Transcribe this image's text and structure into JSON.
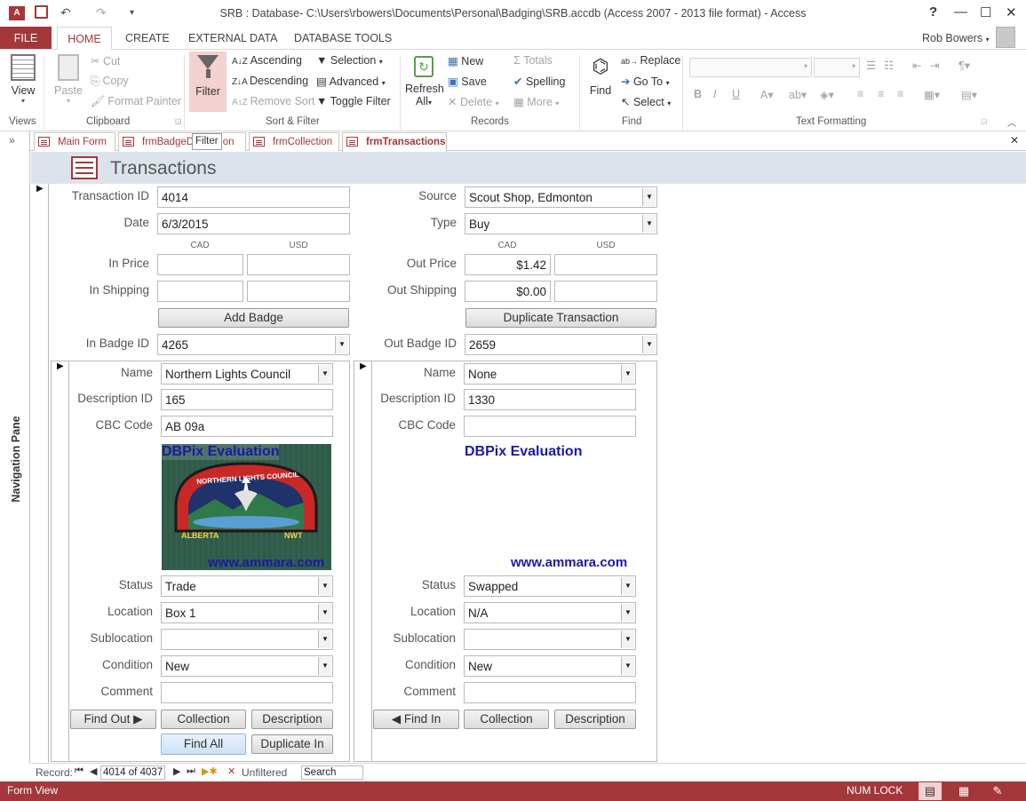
{
  "window": {
    "title": "SRB : Database- C:\\Users\\rbowers\\Documents\\Personal\\Badging\\SRB.accdb (Access 2007 - 2013 file format) - Access",
    "help": "?",
    "minimize": "—",
    "restore": "☐",
    "close": "✕"
  },
  "menu": {
    "file": "FILE",
    "tabs": [
      "HOME",
      "CREATE",
      "EXTERNAL DATA",
      "DATABASE TOOLS"
    ],
    "user": "Rob Bowers"
  },
  "ribbon": {
    "views": {
      "view": "View",
      "group": "Views"
    },
    "clipboard": {
      "paste": "Paste",
      "cut": "Cut",
      "copy": "Copy",
      "format_painter": "Format Painter",
      "group": "Clipboard"
    },
    "sort_filter": {
      "filter": "Filter",
      "ascending": "Ascending",
      "descending": "Descending",
      "remove_sort": "Remove Sort",
      "selection": "Selection",
      "advanced": "Advanced",
      "toggle_filter": "Toggle Filter",
      "group": "Sort & Filter"
    },
    "records": {
      "refresh": "Refresh",
      "refresh_all": "All",
      "new": "New",
      "save": "Save",
      "delete": "Delete",
      "totals": "Totals",
      "spelling": "Spelling",
      "more": "More",
      "group": "Records"
    },
    "find": {
      "find": "Find",
      "replace": "Replace",
      "goto": "Go To",
      "select": "Select",
      "group": "Find"
    },
    "text_formatting": {
      "group": "Text Formatting"
    }
  },
  "tooltip": "Filter",
  "doc_tabs": [
    "Main Form",
    "frmBadgeD",
    "ion",
    "frmCollection",
    "frmTransactions"
  ],
  "nav_pane": "Navigation Pane",
  "form": {
    "title": "Transactions",
    "transaction_id_label": "Transaction ID",
    "transaction_id": "4014",
    "date_label": "Date",
    "date": "6/3/2015",
    "source_label": "Source",
    "source": "Scout Shop, Edmonton",
    "type_label": "Type",
    "type": "Buy",
    "cad": "CAD",
    "usd": "USD",
    "in_price_label": "In Price",
    "in_shipping_label": "In Shipping",
    "out_price_label": "Out Price",
    "out_price_cad": "$1.42",
    "out_shipping_label": "Out Shipping",
    "out_shipping_cad": "$0.00",
    "add_badge": "Add Badge",
    "duplicate_transaction": "Duplicate Transaction",
    "in_badge_label": "In Badge ID",
    "in_badge": "4265",
    "out_badge_label": "Out Badge ID",
    "out_badge": "2659"
  },
  "left_sub": {
    "name_label": "Name",
    "name": "Northern Lights Council",
    "desc_label": "Description ID",
    "desc": "165",
    "cbc_label": "CBC Code",
    "cbc": "AB 09a",
    "watermark_top": "DBPix Evaluation",
    "watermark_bottom": "www.ammara.com",
    "patch_text_top": "NORTHERN LIGHTS COUNCIL",
    "patch_left": "ALBERTA",
    "patch_right": "NWT",
    "status_label": "Status",
    "status": "Trade",
    "location_label": "Location",
    "location": "Box 1",
    "subloc_label": "Sublocation",
    "subloc": "",
    "condition_label": "Condition",
    "condition": "New",
    "comment_label": "Comment",
    "find_out": "Find Out ▶",
    "collection": "Collection",
    "description": "Description",
    "find_all": "Find All",
    "duplicate_in": "Duplicate In"
  },
  "right_sub": {
    "name_label": "Name",
    "name": "None",
    "desc_label": "Description ID",
    "desc": "1330",
    "cbc_label": "CBC Code",
    "cbc": "",
    "watermark_top": "DBPix Evaluation",
    "watermark_bottom": "www.ammara.com",
    "status_label": "Status",
    "status": "Swapped",
    "location_label": "Location",
    "location": "N/A",
    "subloc_label": "Sublocation",
    "subloc": "",
    "condition_label": "Condition",
    "condition": "New",
    "comment_label": "Comment",
    "find_in": "◀ Find In",
    "collection": "Collection",
    "description": "Description"
  },
  "record_nav": {
    "label": "Record:",
    "position": "4014 of 4037",
    "filter": "Unfiltered",
    "search": "Search"
  },
  "status": {
    "view": "Form View",
    "numlock": "NUM LOCK"
  },
  "colors": {
    "accent": "#a4373a",
    "header": "#dde3ed",
    "link_blue": "#1a1aa6"
  }
}
